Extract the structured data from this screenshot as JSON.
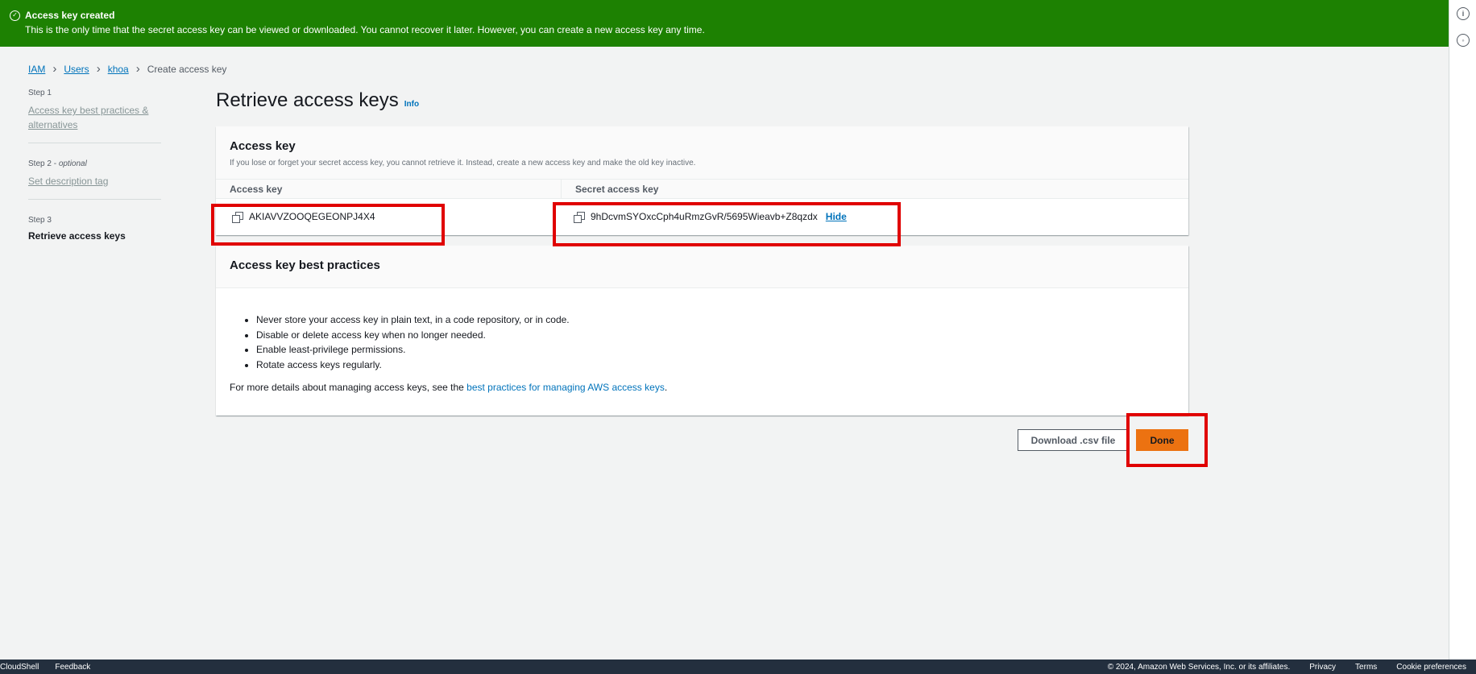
{
  "flash": {
    "title": "Access key created",
    "message": "This is the only time that the secret access key can be viewed or downloaded. You cannot recover it later. However, you can create a new access key any time."
  },
  "breadcrumb": {
    "items": [
      "IAM",
      "Users",
      "khoa"
    ],
    "current": "Create access key"
  },
  "steps": [
    {
      "num": "Step 1",
      "label": "Access key best practices & alternatives"
    },
    {
      "num": "Step 2",
      "optional": "optional",
      "label": "Set description tag"
    },
    {
      "num": "Step 3",
      "label": "Retrieve access keys"
    }
  ],
  "page": {
    "title": "Retrieve access keys",
    "info": "Info"
  },
  "access_key_panel": {
    "title": "Access key",
    "description": "If you lose or forget your secret access key, you cannot retrieve it. Instead, create a new access key and make the old key inactive.",
    "col_access_key": "Access key",
    "col_secret_key": "Secret access key",
    "access_key_value": "AKIAVVZOOQEGEONPJ4X4",
    "secret_key_value": "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",
    "hide_label": "Hide"
  },
  "best_practices_panel": {
    "title": "Access key best practices",
    "items": [
      "Never store your access key in plain text, in a code repository, or in code.",
      "Disable or delete access key when no longer needed.",
      "Enable least-privilege permissions.",
      "Rotate access keys regularly."
    ],
    "footer_prefix": "For more details about managing access keys, see the ",
    "footer_link": "best practices for managing AWS access keys",
    "footer_suffix": "."
  },
  "actions": {
    "download_label": "Download .csv file",
    "done_label": "Done"
  },
  "footer": {
    "cloudshell": "CloudShell",
    "feedback": "Feedback",
    "copyright": "© 2024, Amazon Web Services, Inc. or its affiliates.",
    "privacy": "Privacy",
    "terms": "Terms",
    "cookies": "Cookie preferences"
  },
  "colors": {
    "flash_success": "#1d8102",
    "primary_button": "#ec7211",
    "link": "#0073bb",
    "highlight": "#e00000",
    "footer_bg": "#232f3e"
  }
}
